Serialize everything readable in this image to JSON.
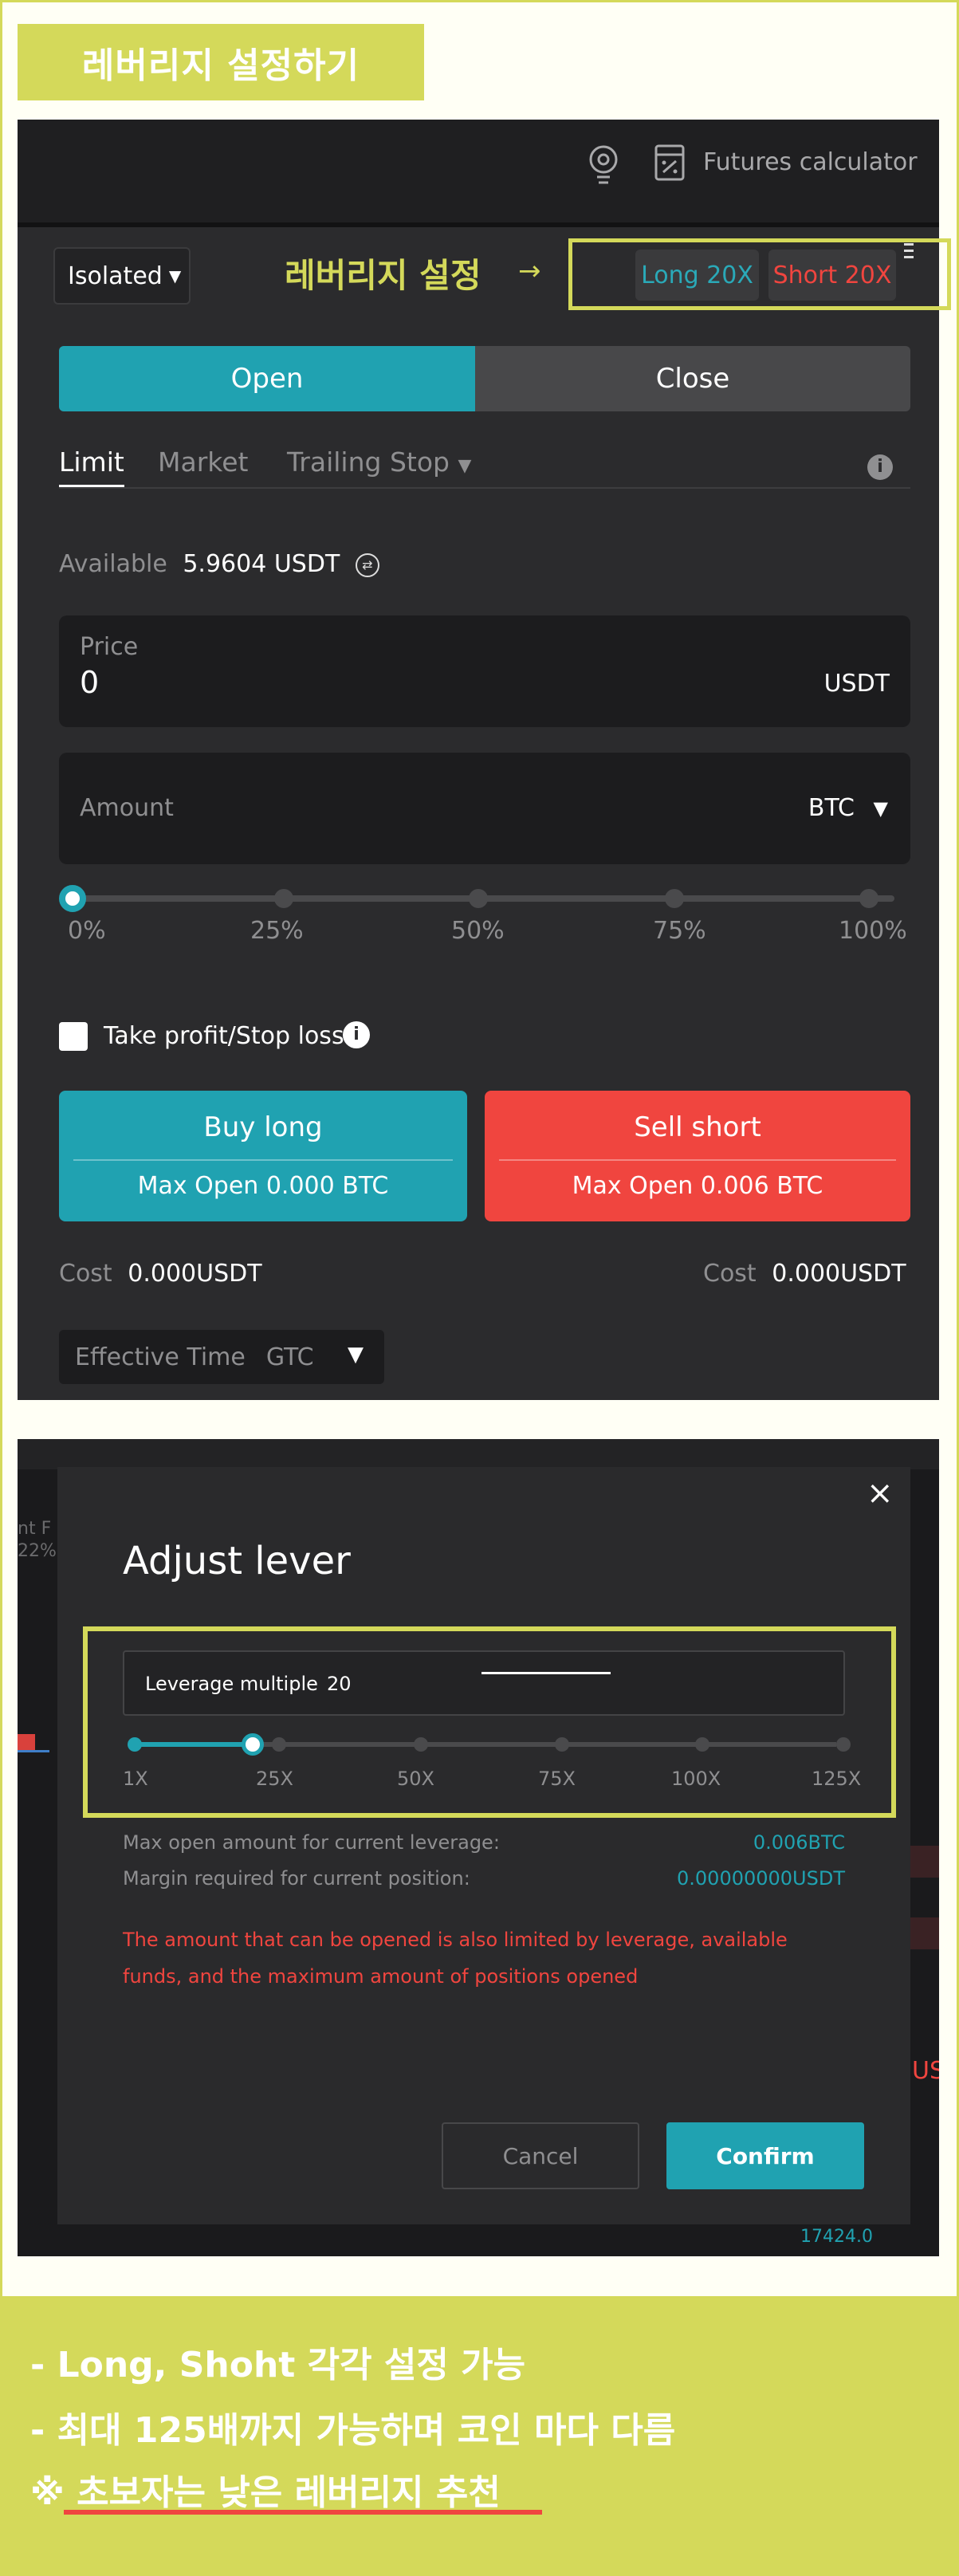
{
  "banner": {
    "title": "레버리지 설정하기"
  },
  "panel1": {
    "futures_calculator": "Futures calculator",
    "margin_mode": "Isolated",
    "annotation_label": "레버리지 설정",
    "annotation_arrow": "→",
    "long_leverage": "Long 20X",
    "short_leverage": "Short 20X",
    "open_tab": "Open",
    "close_tab": "Close",
    "order_types": [
      "Limit",
      "Market",
      "Trailing Stop"
    ],
    "available_label": "Available",
    "available_value": "5.9604 USDT",
    "price_label": "Price",
    "price_value": "0",
    "price_unit": "USDT",
    "amount_label": "Amount",
    "amount_unit": "BTC",
    "slider_marks": [
      "0%",
      "25%",
      "50%",
      "75%",
      "100%"
    ],
    "slider_value_pct": 0,
    "tp_sl_label": "Take profit/Stop loss",
    "buy_long": {
      "title": "Buy long",
      "sub": "Max Open 0.000 BTC"
    },
    "sell_short": {
      "title": "Sell short",
      "sub": "Max Open 0.006 BTC"
    },
    "cost_label": "Cost",
    "cost_long": "0.000USDT",
    "cost_short": "0.000USDT",
    "effective_time_label": "Effective Time",
    "effective_time_value": "GTC"
  },
  "panel2": {
    "bg_text_left": "nt F",
    "bg_text_left2": "22%",
    "bg_text_bottom": "17424.0",
    "bg_text_right": "US",
    "title": "Adjust lever",
    "leverage_label": "Leverage multiple",
    "leverage_value": "20",
    "marks": [
      "1X",
      "25X",
      "50X",
      "75X",
      "100X",
      "125X"
    ],
    "slider_value": 20,
    "max_open_label": "Max open amount for current leverage:",
    "max_open_value": "0.006BTC",
    "margin_label": "Margin required for current position:",
    "margin_value": "0.00000000USDT",
    "warning": "The amount that can be opened is also limited by leverage, available funds, and the maximum amount of positions opened",
    "cancel": "Cancel",
    "confirm": "Confirm"
  },
  "notes": {
    "line1": "- Long, Shoht 각각 설정 가능",
    "line2": "- 최대 125배까지 가능하며 코인 마다 다름",
    "line3": "※ 초보자는 낮은 레버리지 추천"
  },
  "colors": {
    "accent": "#20a2b1",
    "danger": "#f0453f",
    "highlight": "#d4d95a"
  }
}
